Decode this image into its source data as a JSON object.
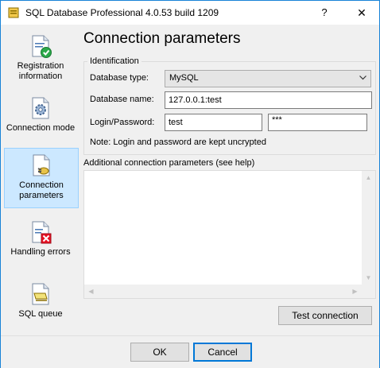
{
  "window": {
    "title": "SQL Database Professional 4.0.53 build 1209",
    "help": "?",
    "close": "✕"
  },
  "sidebar": {
    "items": [
      {
        "label": "Registration information",
        "icon": "registration-check-icon"
      },
      {
        "label": "Connection mode",
        "icon": "gear-document-icon"
      },
      {
        "label": "Connection parameters",
        "icon": "plug-document-icon",
        "selected": true
      },
      {
        "label": "Handling errors",
        "icon": "error-document-icon"
      },
      {
        "label": "SQL queue",
        "icon": "queue-document-icon"
      }
    ]
  },
  "main": {
    "heading": "Connection parameters",
    "identification": {
      "group_label": "Identification",
      "db_type_label": "Database type:",
      "db_type_value": "MySQL",
      "db_name_label": "Database name:",
      "db_name_value": "127.0.0.1:test",
      "login_label": "Login/Password:",
      "login_value": "test",
      "password_value": "***",
      "note": "Note: Login and password are kept uncrypted"
    },
    "additional_label": "Additional connection parameters (see help)",
    "additional_value": "",
    "test_button": "Test connection"
  },
  "footer": {
    "ok": "OK",
    "cancel": "Cancel"
  },
  "colors": {
    "accent": "#0078d7",
    "selected_bg": "#cce8ff",
    "error_red": "#e81123",
    "ok_green": "#2ba84a"
  }
}
